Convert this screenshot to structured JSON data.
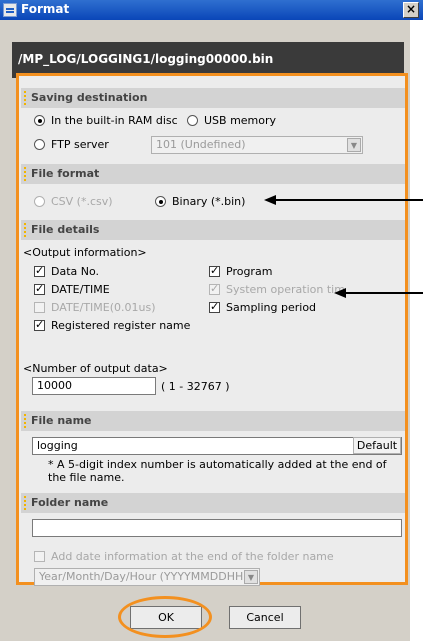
{
  "window": {
    "title": "Format",
    "close_glyph": "×"
  },
  "path": "/MP_LOG/LOGGING1/logging00000.bin",
  "saving_destination": {
    "header": "Saving destination",
    "options": [
      {
        "label": "In the built-in RAM disc",
        "selected": true
      },
      {
        "label": "USB memory",
        "selected": false
      },
      {
        "label": "FTP server",
        "selected": false
      }
    ],
    "ftp_select": "101 (Undefined)"
  },
  "file_format": {
    "header": "File format",
    "options": [
      {
        "label": "CSV (*.csv)",
        "selected": false,
        "disabled": true
      },
      {
        "label": "Binary (*.bin)",
        "selected": true,
        "disabled": false
      }
    ]
  },
  "file_details": {
    "header": "File details",
    "output_info_label": "<Output information>",
    "checks": [
      {
        "label": "Data No.",
        "checked": true,
        "disabled": false
      },
      {
        "label": "DATE/TIME",
        "checked": true,
        "disabled": false
      },
      {
        "label": "DATE/TIME(0.01us)",
        "checked": false,
        "disabled": true
      },
      {
        "label": "Registered register name",
        "checked": true,
        "disabled": false
      },
      {
        "label": "Program",
        "checked": true,
        "disabled": false
      },
      {
        "label": "System operation tim",
        "checked": true,
        "disabled": true
      },
      {
        "label": "Sampling period",
        "checked": true,
        "disabled": false
      }
    ],
    "number_label": "<Number of output data>",
    "number_value": "10000",
    "number_range": "( 1 - 32767 )"
  },
  "file_name": {
    "header": "File name",
    "value": "logging",
    "default_button": "Default",
    "note": "* A 5-digit index number is automatically added at the end of the file name."
  },
  "folder_name": {
    "header": "Folder name",
    "value": "",
    "add_date_label": "Add date information at the end of the folder name",
    "date_format": "Year/Month/Day/Hour (YYYYMMDDHH)"
  },
  "buttons": {
    "ok": "OK",
    "cancel": "Cancel"
  },
  "colors": {
    "highlight": "#f3901f",
    "titlebar": "#0a46b8",
    "section": "#d3d3d3"
  }
}
